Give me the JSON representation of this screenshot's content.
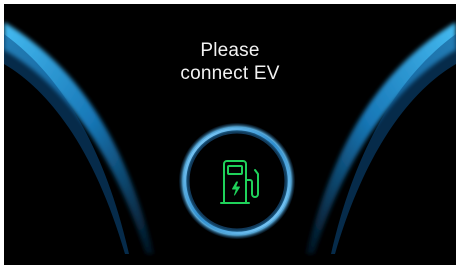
{
  "screen": {
    "background": "#000000",
    "accent_color": "#2aa9e6",
    "icon_color": "#1fd15a"
  },
  "prompt": {
    "line1": "Please",
    "line2": "connect EV"
  },
  "charge_button": {
    "icon": "ev-charger-icon"
  }
}
